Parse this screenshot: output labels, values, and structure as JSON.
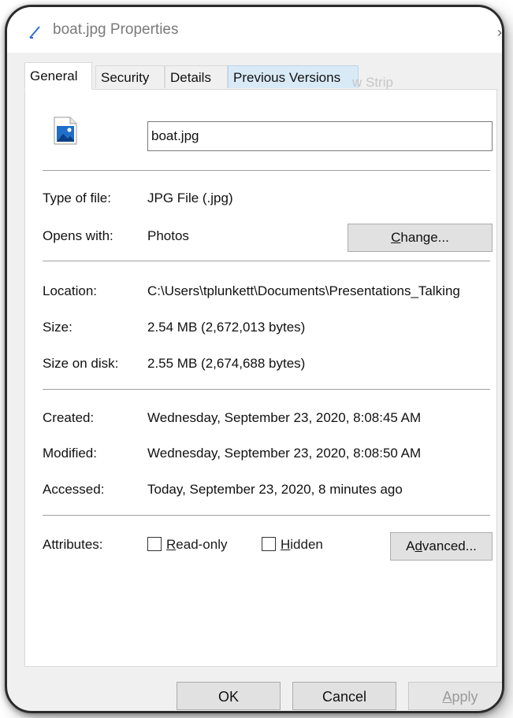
{
  "window": {
    "title": "boat.jpg Properties",
    "icon": "image-file-icon"
  },
  "tabs": [
    {
      "label": "General",
      "active": true
    },
    {
      "label": "Security",
      "active": false
    },
    {
      "label": "Details",
      "active": false
    },
    {
      "label": "Previous Versions",
      "active": false
    }
  ],
  "background_text": "w Strip",
  "file": {
    "icon": "jpg-image-icon",
    "name": "boat.jpg"
  },
  "info": {
    "type_label": "Type of file:",
    "type_value": "JPG File (.jpg)",
    "opens_label": "Opens with:",
    "opens_value": "Photos",
    "change_button": {
      "pre": "",
      "accel": "C",
      "post": "hange..."
    },
    "location_label": "Location:",
    "location_value": "C:\\Users\\tplunkett\\Documents\\Presentations_Talking",
    "size_label": "Size:",
    "size_value": "2.54 MB (2,672,013 bytes)",
    "size_disk_label": "Size on disk:",
    "size_disk_value": "2.55 MB (2,674,688 bytes)"
  },
  "dates": {
    "created_label": "Created:",
    "created_value": "Wednesday, September 23, 2020, 8:08:45 AM",
    "modified_label": "Modified:",
    "modified_value": "Wednesday, September 23, 2020, 8:08:50 AM",
    "accessed_label": "Accessed:",
    "accessed_value": "Today, September 23, 2020, 8 minutes ago"
  },
  "attributes": {
    "label": "Attributes:",
    "readonly": {
      "accel": "R",
      "rest": "ead-only",
      "checked": false
    },
    "hidden": {
      "accel": "H",
      "rest": "idden",
      "checked": false
    },
    "advanced_button": {
      "pre": "A",
      "accel": "d",
      "post": "vanced..."
    }
  },
  "footer": {
    "ok": "OK",
    "cancel": "Cancel",
    "apply": {
      "accel": "A",
      "rest": "pply",
      "disabled": true
    }
  },
  "colors": {
    "panel_bg": "#ffffff",
    "dialog_bg": "#f0f0f0",
    "button_bg": "#e1e1e1",
    "hover_tab": "#d9eaf7"
  }
}
